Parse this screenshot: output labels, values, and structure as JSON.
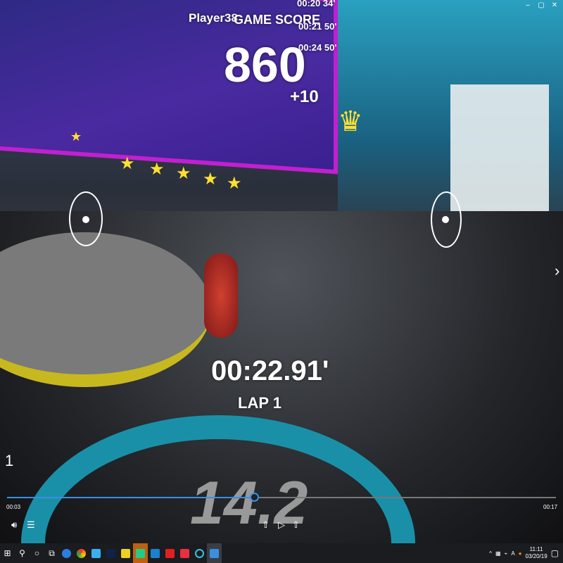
{
  "game": {
    "player": "Player38",
    "score_label": "GAME SCORE",
    "score": "860",
    "bonus": "+10",
    "times": [
      "00:20 34'",
      "00:21 50'",
      "00:24 50'"
    ],
    "timer": "00:22.91'",
    "lap": "LAP 1",
    "speed": "14.2"
  },
  "player": {
    "page_number": "1",
    "elapsed": "00:03",
    "duration": "00:17",
    "progress_percent": 45,
    "next_arrow": "›"
  },
  "window": {
    "minimize": "–",
    "restore": "▢",
    "close": "✕"
  },
  "taskbar": {
    "clock_time": "11:11",
    "clock_date": "03/20/19"
  },
  "colors": {
    "accent": "#3a8ee6",
    "board": "#c020d0",
    "gauge": "#1a90a8"
  }
}
